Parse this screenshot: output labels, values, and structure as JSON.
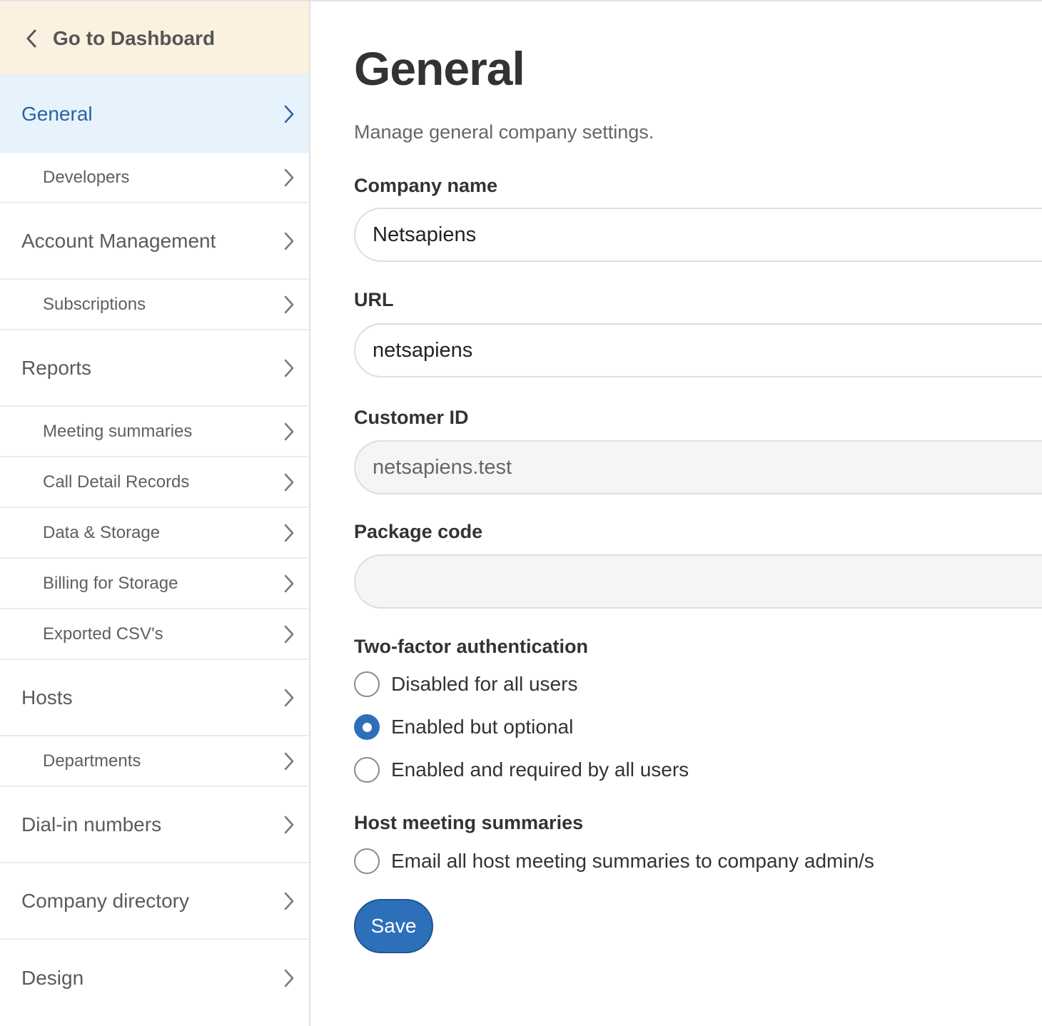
{
  "sidebar": {
    "back_label": "Go to Dashboard",
    "items": [
      {
        "label": "General",
        "level": "top",
        "active": true
      },
      {
        "label": "Developers",
        "level": "sub"
      },
      {
        "label": "Account Management",
        "level": "top"
      },
      {
        "label": "Subscriptions",
        "level": "sub"
      },
      {
        "label": "Reports",
        "level": "top"
      },
      {
        "label": "Meeting summaries",
        "level": "sub"
      },
      {
        "label": "Call Detail Records",
        "level": "sub"
      },
      {
        "label": "Data & Storage",
        "level": "sub"
      },
      {
        "label": "Billing for Storage",
        "level": "sub"
      },
      {
        "label": "Exported CSV's",
        "level": "sub"
      },
      {
        "label": "Hosts",
        "level": "top"
      },
      {
        "label": "Departments",
        "level": "sub"
      },
      {
        "label": "Dial-in numbers",
        "level": "top"
      },
      {
        "label": "Company directory",
        "level": "top"
      },
      {
        "label": "Design",
        "level": "top"
      }
    ]
  },
  "main": {
    "title": "General",
    "description": "Manage general company settings.",
    "company_name": {
      "label": "Company name",
      "value": "Netsapiens"
    },
    "url": {
      "label": "URL",
      "value": "netsapiens"
    },
    "customer_id": {
      "label": "Customer ID",
      "value": "netsapiens.test"
    },
    "package_code": {
      "label": "Package code",
      "value": ""
    },
    "two_factor": {
      "label": "Two-factor authentication",
      "options": [
        {
          "label": "Disabled for all users",
          "checked": false
        },
        {
          "label": "Enabled but optional",
          "checked": true
        },
        {
          "label": "Enabled and required by all users",
          "checked": false
        }
      ]
    },
    "host_summaries": {
      "label": "Host meeting summaries",
      "option": {
        "label": "Email all host meeting summaries to company admin/s",
        "checked": false
      }
    },
    "save_label": "Save"
  },
  "colors": {
    "accent": "#2e6fba",
    "active_bg": "#e6f3fd",
    "back_bg": "#fbf1e1"
  },
  "icons": {
    "back": "chevron-left-icon",
    "nav": "chevron-right-icon"
  }
}
